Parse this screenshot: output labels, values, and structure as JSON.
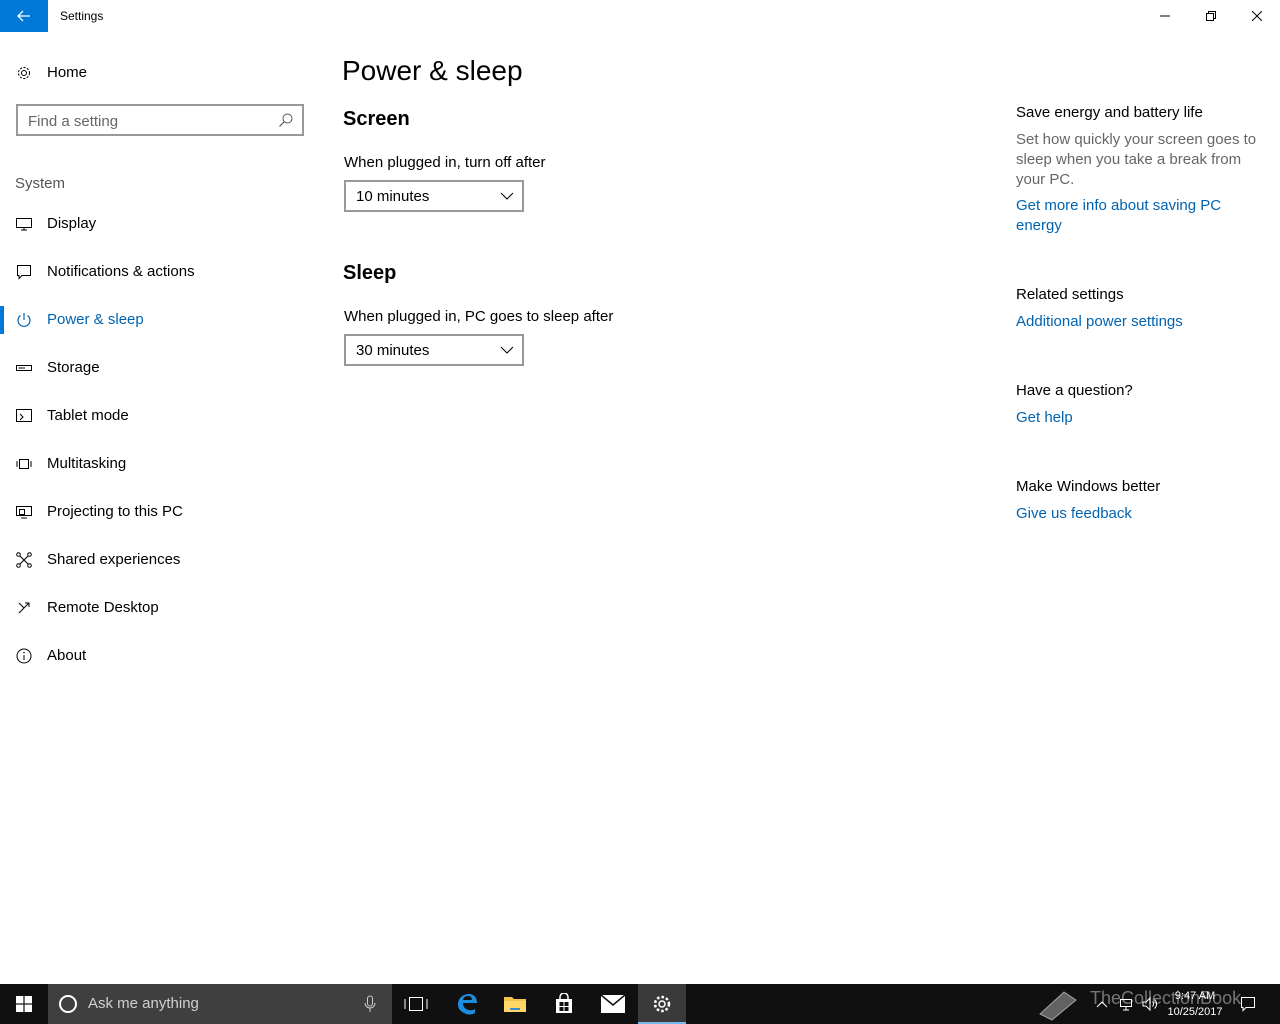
{
  "window": {
    "title": "Settings"
  },
  "sidebar": {
    "home_label": "Home",
    "search_placeholder": "Find a setting",
    "group_label": "System",
    "items": [
      {
        "label": "Display",
        "icon": "monitor-icon"
      },
      {
        "label": "Notifications & actions",
        "icon": "message-icon"
      },
      {
        "label": "Power & sleep",
        "icon": "power-icon",
        "active": true
      },
      {
        "label": "Storage",
        "icon": "storage-icon"
      },
      {
        "label": "Tablet mode",
        "icon": "tablet-icon"
      },
      {
        "label": "Multitasking",
        "icon": "multitasking-icon"
      },
      {
        "label": "Projecting to this PC",
        "icon": "projector-icon"
      },
      {
        "label": "Shared experiences",
        "icon": "share-icon"
      },
      {
        "label": "Remote Desktop",
        "icon": "remote-icon"
      },
      {
        "label": "About",
        "icon": "info-icon"
      }
    ]
  },
  "main": {
    "title": "Power & sleep",
    "screen": {
      "heading": "Screen",
      "label": "When plugged in, turn off after",
      "value": "10 minutes"
    },
    "sleep": {
      "heading": "Sleep",
      "label": "When plugged in, PC goes to sleep after",
      "value": "30 minutes"
    }
  },
  "right": {
    "energy_heading": "Save energy and battery life",
    "energy_text": "Set how quickly your screen goes to sleep when you take a break from your PC.",
    "energy_link": "Get more info about saving PC energy",
    "related_heading": "Related settings",
    "related_link": "Additional power settings",
    "question_heading": "Have a question?",
    "question_link": "Get help",
    "better_heading": "Make Windows better",
    "better_link": "Give us feedback"
  },
  "taskbar": {
    "search_placeholder": "Ask me anything",
    "time": "9:47 AM",
    "date": "10/25/2017",
    "watermark": "TheCollectionBook"
  },
  "colors": {
    "accent": "#0078d7",
    "link": "#0063b1",
    "taskbar": "#101010",
    "search_box": "#3f3f3f"
  }
}
